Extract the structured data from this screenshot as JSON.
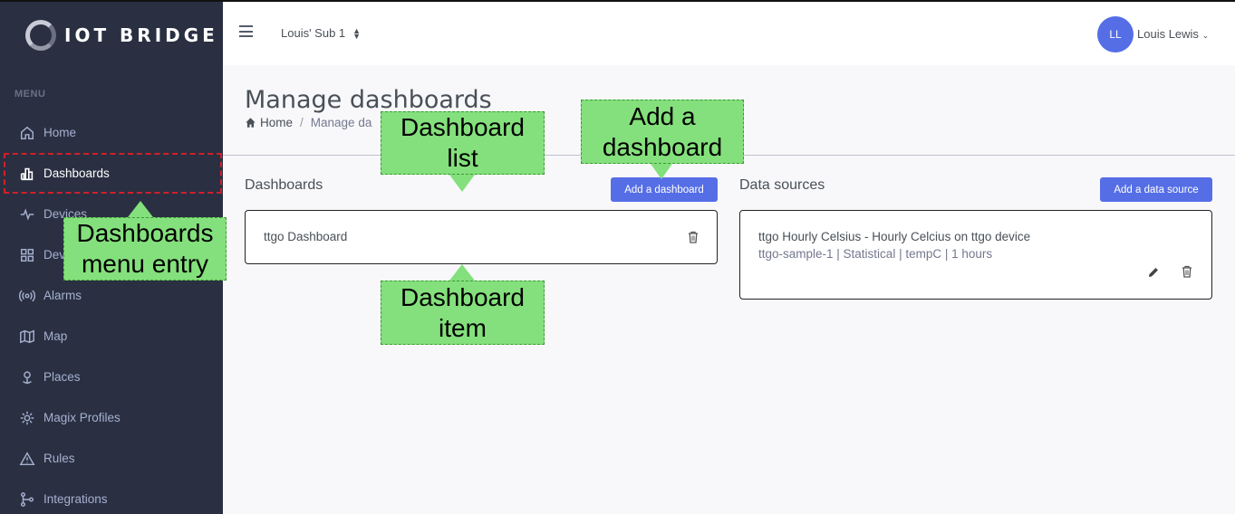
{
  "brand": {
    "name": "IOT BRIDGE"
  },
  "sidebar": {
    "menu_title": "MENU",
    "items": [
      {
        "label": "Home",
        "icon": "home-icon"
      },
      {
        "label": "Dashboards",
        "icon": "bar-chart-icon"
      },
      {
        "label": "Devices",
        "icon": "pulse-icon"
      },
      {
        "label": "Dev",
        "icon": "grid-icon"
      },
      {
        "label": "Alarms",
        "icon": "broadcast-icon"
      },
      {
        "label": "Map",
        "icon": "map-icon"
      },
      {
        "label": "Places",
        "icon": "pin-icon"
      },
      {
        "label": "Magix Profiles",
        "icon": "gear-icon"
      },
      {
        "label": "Rules",
        "icon": "warning-icon"
      },
      {
        "label": "Integrations",
        "icon": "git-branch-icon"
      }
    ]
  },
  "topbar": {
    "subscription": "Louis' Sub 1",
    "user_initials": "LL",
    "user_name": "Louis Lewis"
  },
  "page": {
    "title": "Manage dashboards",
    "breadcrumb_home": "Home",
    "breadcrumb_current": "Manage da"
  },
  "dashboards": {
    "title": "Dashboards",
    "add_button": "Add a dashboard",
    "items": [
      {
        "name": "ttgo Dashboard"
      }
    ]
  },
  "datasources": {
    "title": "Data sources",
    "add_button": "Add a data source",
    "items": [
      {
        "name": "ttgo Hourly Celsius - Hourly Celcius on ttgo device",
        "details": "ttgo-sample-1 | Statistical | tempC | 1 hours"
      }
    ]
  },
  "callouts": {
    "dashboard_list": "Dashboard list",
    "add_dashboard": "Add a dashboard",
    "menu_entry": "Dashboards menu entry",
    "dashboard_item": "Dashboard item"
  },
  "colors": {
    "sidebar": "#2a3042",
    "accent": "#556ee6",
    "callout": "#84e07c",
    "highlight": "#d21f2a"
  }
}
